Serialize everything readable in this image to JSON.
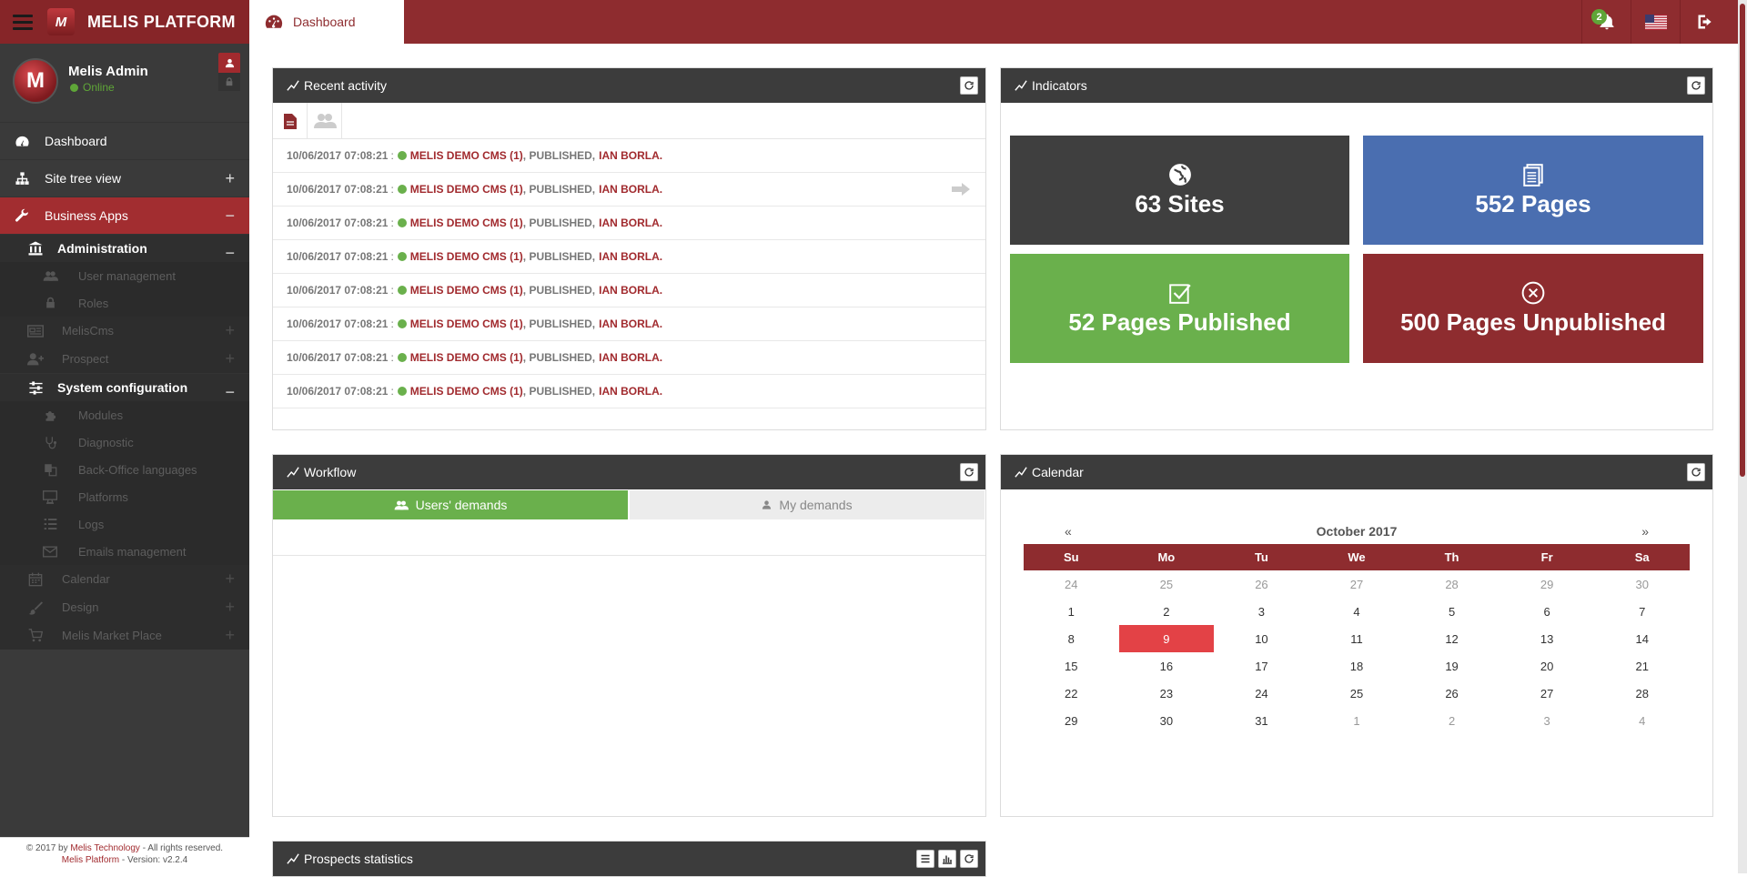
{
  "app": {
    "brand": "MELIS PLATFORM",
    "logo_letter": "M",
    "active_tab": "Dashboard",
    "notification_count": "2"
  },
  "user": {
    "avatar_letter": "M",
    "name": "Melis Admin",
    "status": "Online"
  },
  "sidebar": {
    "items": [
      {
        "label": "Dashboard",
        "icon": "dashboard-icon",
        "level": 1
      },
      {
        "label": "Site tree view",
        "icon": "sitemap-icon",
        "level": 1,
        "toggle": "+"
      },
      {
        "label": "Business Apps",
        "icon": "wrench-icon",
        "level": 1,
        "toggle": "−",
        "active": true
      },
      {
        "label": "Administration",
        "icon": "bank-icon",
        "level": 2,
        "toggle": "−"
      },
      {
        "label": "User management",
        "icon": "users-icon",
        "level": 3
      },
      {
        "label": "Roles",
        "icon": "lock-icon",
        "level": 3
      },
      {
        "label": "MelisCms",
        "icon": "newspaper-icon",
        "level": 2,
        "dim": true,
        "toggle": "+"
      },
      {
        "label": "Prospect",
        "icon": "user-plus-icon",
        "level": 2,
        "dim": true,
        "toggle": "+"
      },
      {
        "label": "System configuration",
        "icon": "sliders-icon",
        "level": 2,
        "toggle": "−"
      },
      {
        "label": "Modules",
        "icon": "puzzle-icon",
        "level": 3
      },
      {
        "label": "Diagnostic",
        "icon": "stethoscope-icon",
        "level": 3
      },
      {
        "label": "Back-Office languages",
        "icon": "language-icon",
        "level": 3
      },
      {
        "label": "Platforms",
        "icon": "desktop-icon",
        "level": 3
      },
      {
        "label": "Logs",
        "icon": "list-icon",
        "level": 3
      },
      {
        "label": "Emails management",
        "icon": "envelope-icon",
        "level": 3
      },
      {
        "label": "Calendar",
        "icon": "calendar-icon",
        "level": 2,
        "dim": true,
        "toggle": "+"
      },
      {
        "label": "Design",
        "icon": "brush-icon",
        "level": 2,
        "dim": true,
        "toggle": "+"
      },
      {
        "label": "Melis Market Place",
        "icon": "cart-icon",
        "level": 2,
        "dim": true,
        "toggle": "+"
      }
    ],
    "footer_line1_prefix": "© 2017 by ",
    "footer_line1_company": "Melis Technology",
    "footer_line1_suffix": " - All rights reserved.",
    "footer_line2_prefix": "Melis Platform",
    "footer_line2_suffix": " - Version: v2.2.4"
  },
  "recent_activity": {
    "title": "Recent activity",
    "rows": [
      {
        "date": "10/06/2017 07:08:21",
        "sep": ":",
        "site": "MELIS DEMO CMS (1)",
        "status": ", PUBLISHED,",
        "user": "IAN BORLA."
      },
      {
        "date": "10/06/2017 07:08:21",
        "sep": ":",
        "site": "MELIS DEMO CMS (1)",
        "status": ", PUBLISHED,",
        "user": "IAN BORLA."
      },
      {
        "date": "10/06/2017 07:08:21",
        "sep": ":",
        "site": "MELIS DEMO CMS (1)",
        "status": ", PUBLISHED,",
        "user": "IAN BORLA."
      },
      {
        "date": "10/06/2017 07:08:21",
        "sep": ":",
        "site": "MELIS DEMO CMS (1)",
        "status": ", PUBLISHED,",
        "user": "IAN BORLA."
      },
      {
        "date": "10/06/2017 07:08:21",
        "sep": ":",
        "site": "MELIS DEMO CMS (1)",
        "status": ", PUBLISHED,",
        "user": "IAN BORLA."
      },
      {
        "date": "10/06/2017 07:08:21",
        "sep": ":",
        "site": "MELIS DEMO CMS (1)",
        "status": ", PUBLISHED,",
        "user": "IAN BORLA."
      },
      {
        "date": "10/06/2017 07:08:21",
        "sep": ":",
        "site": "MELIS DEMO CMS (1)",
        "status": ", PUBLISHED,",
        "user": "IAN BORLA."
      },
      {
        "date": "10/06/2017 07:08:21",
        "sep": ":",
        "site": "MELIS DEMO CMS (1)",
        "status": ", PUBLISHED,",
        "user": "IAN BORLA."
      }
    ]
  },
  "indicators": {
    "title": "Indicators",
    "tiles": [
      {
        "label": "63 Sites",
        "color": "#3f3f3f",
        "icon": "globe-icon"
      },
      {
        "label": "552 Pages",
        "color": "#4a6eb0",
        "icon": "pages-icon"
      },
      {
        "label": "52 Pages Published",
        "color": "#6ab04c",
        "icon": "check-square-icon"
      },
      {
        "label": "500 Pages Unpublished",
        "color": "#8e2c2f",
        "icon": "times-circle-icon"
      }
    ]
  },
  "workflow": {
    "title": "Workflow",
    "tab_users": "Users' demands",
    "tab_mine": "My demands"
  },
  "calendar": {
    "title": "Calendar",
    "prev": "«",
    "next": "»",
    "month": "October 2017",
    "weekdays": [
      "Su",
      "Mo",
      "Tu",
      "We",
      "Th",
      "Fr",
      "Sa"
    ],
    "days": [
      {
        "d": "24",
        "m": true
      },
      {
        "d": "25",
        "m": true
      },
      {
        "d": "26",
        "m": true
      },
      {
        "d": "27",
        "m": true
      },
      {
        "d": "28",
        "m": true
      },
      {
        "d": "29",
        "m": true
      },
      {
        "d": "30",
        "m": true
      },
      {
        "d": "1"
      },
      {
        "d": "2"
      },
      {
        "d": "3"
      },
      {
        "d": "4"
      },
      {
        "d": "5"
      },
      {
        "d": "6"
      },
      {
        "d": "7"
      },
      {
        "d": "8"
      },
      {
        "d": "9",
        "today": true
      },
      {
        "d": "10"
      },
      {
        "d": "11"
      },
      {
        "d": "12"
      },
      {
        "d": "13"
      },
      {
        "d": "14"
      },
      {
        "d": "15"
      },
      {
        "d": "16"
      },
      {
        "d": "17"
      },
      {
        "d": "18"
      },
      {
        "d": "19"
      },
      {
        "d": "20"
      },
      {
        "d": "21"
      },
      {
        "d": "22"
      },
      {
        "d": "23"
      },
      {
        "d": "24"
      },
      {
        "d": "25"
      },
      {
        "d": "26"
      },
      {
        "d": "27"
      },
      {
        "d": "28"
      },
      {
        "d": "29"
      },
      {
        "d": "30"
      },
      {
        "d": "31"
      },
      {
        "d": "1",
        "m": true
      },
      {
        "d": "2",
        "m": true
      },
      {
        "d": "3",
        "m": true
      },
      {
        "d": "4",
        "m": true
      }
    ]
  },
  "prospects": {
    "title": "Prospects statistics"
  },
  "colors": {
    "brand": "#8e2c2f",
    "success": "#6ab04c",
    "info": "#4a6eb0",
    "dark": "#3f3f3f",
    "today": "#e34246"
  }
}
